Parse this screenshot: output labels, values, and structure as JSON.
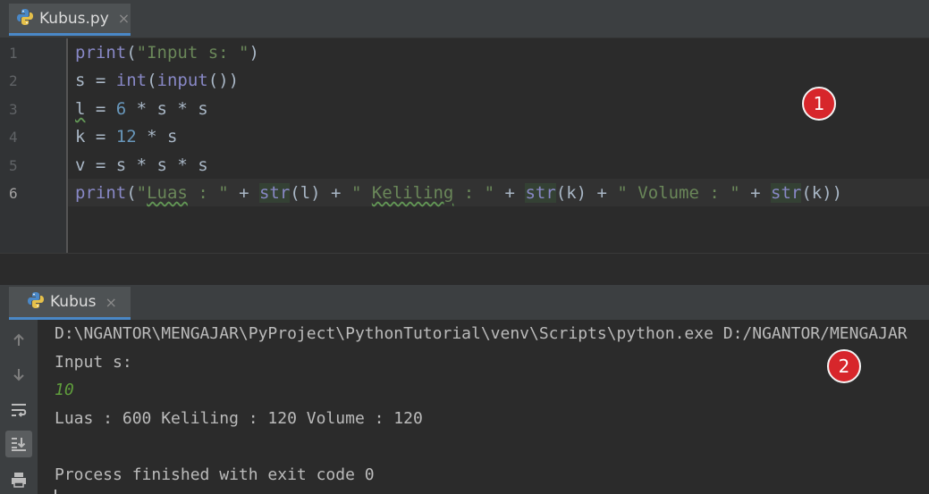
{
  "editor_tab": {
    "label": "Kubus.py",
    "close": "×"
  },
  "code": {
    "line_numbers": [
      "1",
      "2",
      "3",
      "4",
      "5",
      "6"
    ],
    "lines": [
      [
        {
          "t": "print",
          "c": "kw"
        },
        {
          "t": "(",
          "c": "p"
        },
        {
          "t": "\"Input s: \"",
          "c": "str"
        },
        {
          "t": ")",
          "c": "p"
        }
      ],
      [
        {
          "t": "s = ",
          "c": "p"
        },
        {
          "t": "int",
          "c": "kw"
        },
        {
          "t": "(",
          "c": "p"
        },
        {
          "t": "input",
          "c": "kw"
        },
        {
          "t": "())",
          "c": "p"
        }
      ],
      [
        {
          "t": "l",
          "c": "squig"
        },
        {
          "t": " = ",
          "c": "p"
        },
        {
          "t": "6",
          "c": "num"
        },
        {
          "t": " * s * s",
          "c": "p"
        }
      ],
      [
        {
          "t": "k = ",
          "c": "p"
        },
        {
          "t": "12",
          "c": "num"
        },
        {
          "t": " * s",
          "c": "p"
        }
      ],
      [
        {
          "t": "v = s * s * s",
          "c": "p"
        }
      ],
      [
        {
          "t": "print",
          "c": "kw"
        },
        {
          "t": "(",
          "c": "p"
        },
        {
          "t": "\"",
          "c": "str"
        },
        {
          "t": "Luas",
          "c": "strsquig"
        },
        {
          "t": " : \"",
          "c": "str"
        },
        {
          "t": " + ",
          "c": "p"
        },
        {
          "t": "str",
          "c": "builtin"
        },
        {
          "t": "(l) + ",
          "c": "p"
        },
        {
          "t": "\" ",
          "c": "str"
        },
        {
          "t": "Keliling",
          "c": "strsquig"
        },
        {
          "t": " : \"",
          "c": "str"
        },
        {
          "t": " + ",
          "c": "p"
        },
        {
          "t": "str",
          "c": "builtin"
        },
        {
          "t": "(k) + ",
          "c": "p"
        },
        {
          "t": "\" Volume : \"",
          "c": "str"
        },
        {
          "t": " + ",
          "c": "p"
        },
        {
          "t": "str",
          "c": "builtin"
        },
        {
          "t": "(k))",
          "c": "p"
        }
      ]
    ]
  },
  "badges": {
    "one": "1",
    "two": "2"
  },
  "run_tab": {
    "label": "Kubus",
    "close": "×"
  },
  "console": {
    "command": "D:\\NGANTOR\\MENGAJAR\\PyProject\\PythonTutorial\\venv\\Scripts\\python.exe D:/NGANTOR/MENGAJAR",
    "prompt": "Input s:",
    "user_input": "10",
    "result": "Luas : 600 Keliling : 120 Volume : 120",
    "blank": "",
    "exit": "Process finished with exit code 0"
  },
  "icons": {
    "tab": "python-icon",
    "tools": [
      "up-arrow-icon",
      "down-arrow-icon",
      "soft-wrap-icon",
      "scroll-to-end-icon",
      "print-icon"
    ]
  },
  "colors": {
    "keyword": "#8888c6",
    "string": "#6a8759",
    "number": "#6897bb",
    "text": "#a9b7c6",
    "badge": "#d7262b",
    "input": "#5f9d3c"
  }
}
